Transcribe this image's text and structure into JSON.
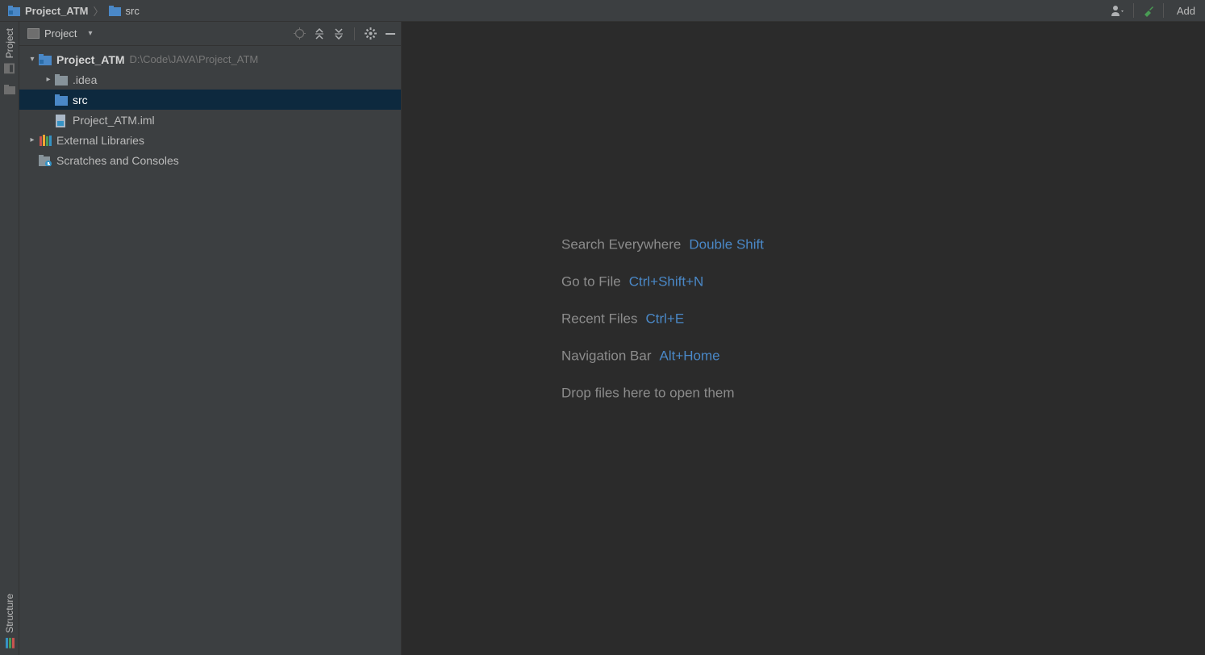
{
  "nav": {
    "crumb1": "Project_ATM",
    "crumb2": "src",
    "add_config": "Add"
  },
  "gutter": {
    "project_tab": "Project",
    "structure_tab": "Structure"
  },
  "tool": {
    "title": "Project"
  },
  "tree": {
    "root": {
      "label": "Project_ATM",
      "path": "D:\\Code\\JAVA\\Project_ATM"
    },
    "idea": ".idea",
    "src": "src",
    "iml": "Project_ATM.iml",
    "extlib": "External Libraries",
    "scratch": "Scratches and Consoles"
  },
  "tips": {
    "search_label": "Search Everywhere",
    "search_key": "Double Shift",
    "goto_label": "Go to File",
    "goto_key": "Ctrl+Shift+N",
    "recent_label": "Recent Files",
    "recent_key": "Ctrl+E",
    "navbar_label": "Navigation Bar",
    "navbar_key": "Alt+Home",
    "drop": "Drop files here to open them"
  }
}
